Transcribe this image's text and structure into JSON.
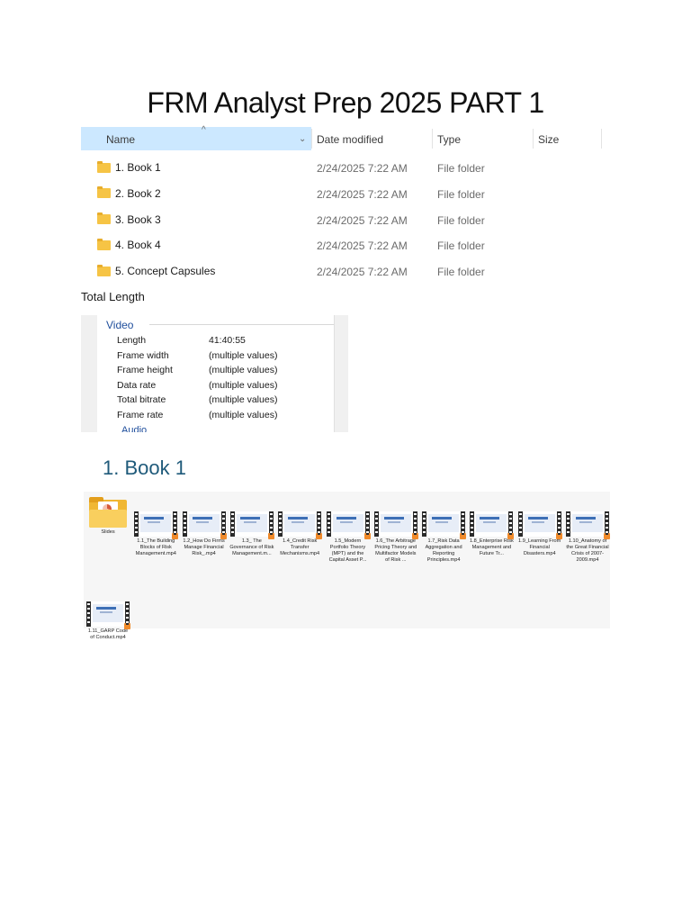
{
  "document": {
    "title": "FRM Analyst Prep 2025 PART 1",
    "total_length_label": "Total Length",
    "section_heading": "1. Book 1"
  },
  "explorer": {
    "columns": {
      "name": "Name",
      "date": "Date modified",
      "type": "Type",
      "size": "Size"
    },
    "rows": [
      {
        "name": "1. Book 1",
        "date": "2/24/2025 7:22 AM",
        "type": "File folder"
      },
      {
        "name": "2. Book 2",
        "date": "2/24/2025 7:22 AM",
        "type": "File folder"
      },
      {
        "name": "3. Book 3",
        "date": "2/24/2025 7:22 AM",
        "type": "File folder"
      },
      {
        "name": "4. Book 4",
        "date": "2/24/2025 7:22 AM",
        "type": "File folder"
      },
      {
        "name": "5. Concept Capsules",
        "date": "2/24/2025 7:22 AM",
        "type": "File folder"
      }
    ]
  },
  "properties": {
    "video_heading": "Video",
    "audio_heading": "Audio",
    "rows": [
      {
        "label": "Length",
        "value": "41:40:55"
      },
      {
        "label": "Frame width",
        "value": "(multiple values)"
      },
      {
        "label": "Frame height",
        "value": "(multiple values)"
      },
      {
        "label": "Data rate",
        "value": "(multiple values)"
      },
      {
        "label": "Total bitrate",
        "value": "(multiple values)"
      },
      {
        "label": "Frame rate",
        "value": "(multiple values)"
      }
    ]
  },
  "book1_files": [
    {
      "label": "Slides",
      "kind": "folder"
    },
    {
      "label": "1.1_The Building Blocks of Risk Management.mp4",
      "kind": "video"
    },
    {
      "label": "1.2_How Do Firms Manage Financial Risk_.mp4",
      "kind": "video"
    },
    {
      "label": "1.3_ The Governance of Risk Management.m...",
      "kind": "video"
    },
    {
      "label": "1.4_Credit Risk Transfer Mechanisms.mp4",
      "kind": "video"
    },
    {
      "label": "1.5_Modern Portfolio Theory (MPT) and the Capital Asset P...",
      "kind": "video"
    },
    {
      "label": "1.6_The Arbitrage Pricing Theory and Multifactor Models of Risk ...",
      "kind": "video"
    },
    {
      "label": "1.7_Risk Data Aggregation and Reporting Principles.mp4",
      "kind": "video"
    },
    {
      "label": "1.8_Enterprise Risk Management and Future Tr...",
      "kind": "video"
    },
    {
      "label": "1.9_Learning From Financial Disasters.mp4",
      "kind": "video"
    },
    {
      "label": "1.10_Anatomy of the Great Financial Crisis of 2007-2009.mp4",
      "kind": "video"
    },
    {
      "label": "1.11_GARP Code of Conduct.mp4",
      "kind": "video"
    }
  ]
}
